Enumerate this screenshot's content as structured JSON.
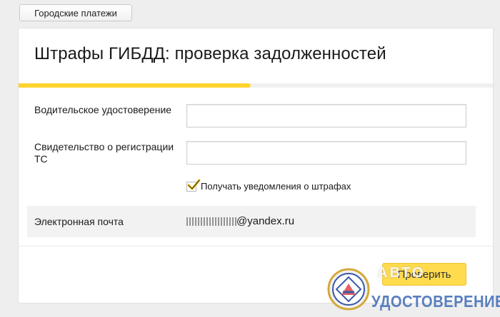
{
  "breadcrumb": {
    "label": "Городские платежи"
  },
  "page": {
    "title": "Штрафы ГИБДД: проверка задолженностей",
    "progress_percent": 49
  },
  "form": {
    "license_label": "Водительское удостоверение",
    "license_value": "",
    "registration_label": "Свидетельство о регистрации ТС",
    "registration_value": "",
    "notify_label": "Получать уведомления о штрафах",
    "notify_checked": true,
    "email_label": "Электронная почта",
    "email_value": "@yandex.ru",
    "submit_label": "Проверить"
  },
  "watermark": {
    "top_text": "АВТО",
    "bottom_text": "УДОСТОВЕРЕНИЕ"
  },
  "colors": {
    "accent": "#ffd42e",
    "button": "#ffdb4d",
    "watermark_text": "#5a7fbf"
  }
}
